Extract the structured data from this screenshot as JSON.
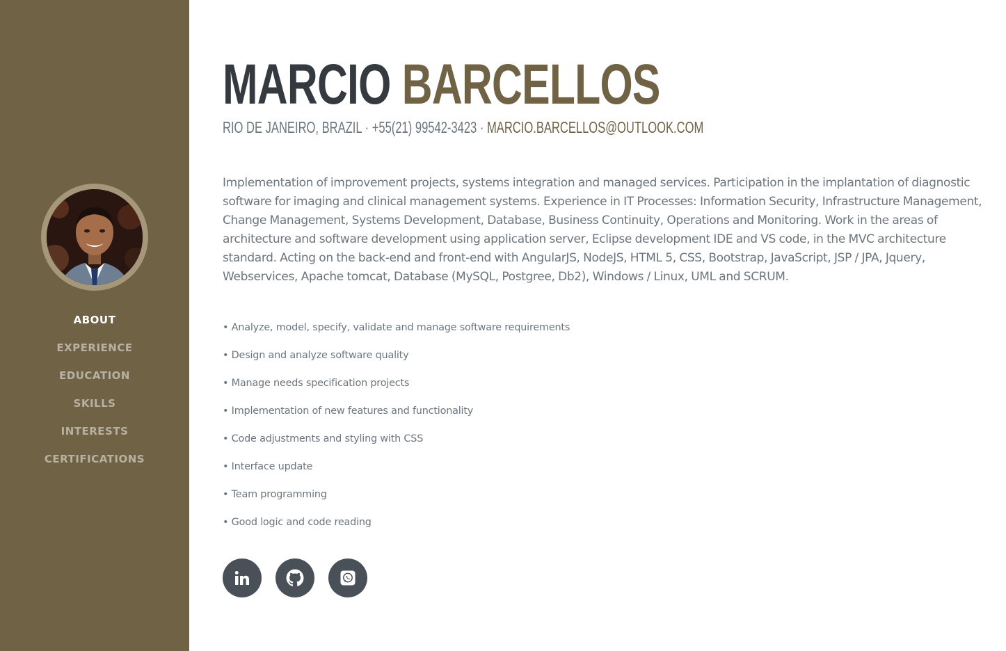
{
  "profile": {
    "first_name": "MARCIO",
    "last_name": "BARCELLOS",
    "location": "RIO DE JANEIRO, BRAZIL",
    "separator": "·",
    "phone": "+55(21) 99542-3423",
    "email": "MARCIO.BARCELLOS@OUTLOOK.COM",
    "photo_icon": "avatar-photo"
  },
  "nav": {
    "items": [
      {
        "label": "ABOUT",
        "active": true
      },
      {
        "label": "EXPERIENCE",
        "active": false
      },
      {
        "label": "EDUCATION",
        "active": false
      },
      {
        "label": "SKILLS",
        "active": false
      },
      {
        "label": "INTERESTS",
        "active": false
      },
      {
        "label": "CERTIFICATIONS",
        "active": false
      }
    ]
  },
  "about": {
    "bio": "Implementation of improvement projects, systems integration and managed services. Participation in the implantation of diagnostic software for imaging and clinical management systems. Experience in IT Processes: Information Security, Infrastructure Management, Change Management, Systems Development, Database, Business Continuity, Operations and Monitoring. Work in the areas of architecture and software development using application server, Eclipse development IDE and VS code, in the MVC architecture standard. Acting on the back-end and front-end with AngularJS, NodeJS, HTML 5, CSS, Bootstrap, JavaScript, JSP / JPA, Jquery, Webservices, Apache tomcat, Database (MySQL, Postgree, Db2), Windows / Linux, UML and SCRUM.",
    "bullets": [
      "• Analyze, model, specify, validate and manage software requirements",
      "• Design and analyze software quality",
      "• Manage needs specification projects",
      "• Implementation of new features and functionality",
      "• Code adjustments and styling with CSS",
      "• Interface update",
      "• Team programming",
      "• Good logic and code reading"
    ]
  },
  "socials": [
    {
      "icon": "linkedin-icon"
    },
    {
      "icon": "github-icon"
    },
    {
      "icon": "whatsapp-icon"
    }
  ],
  "colors": {
    "brand": "#6f6245",
    "dark": "#343a40",
    "text_muted": "#6c757d",
    "social_bg": "#495057",
    "avatar_ring": "#a6977a"
  }
}
